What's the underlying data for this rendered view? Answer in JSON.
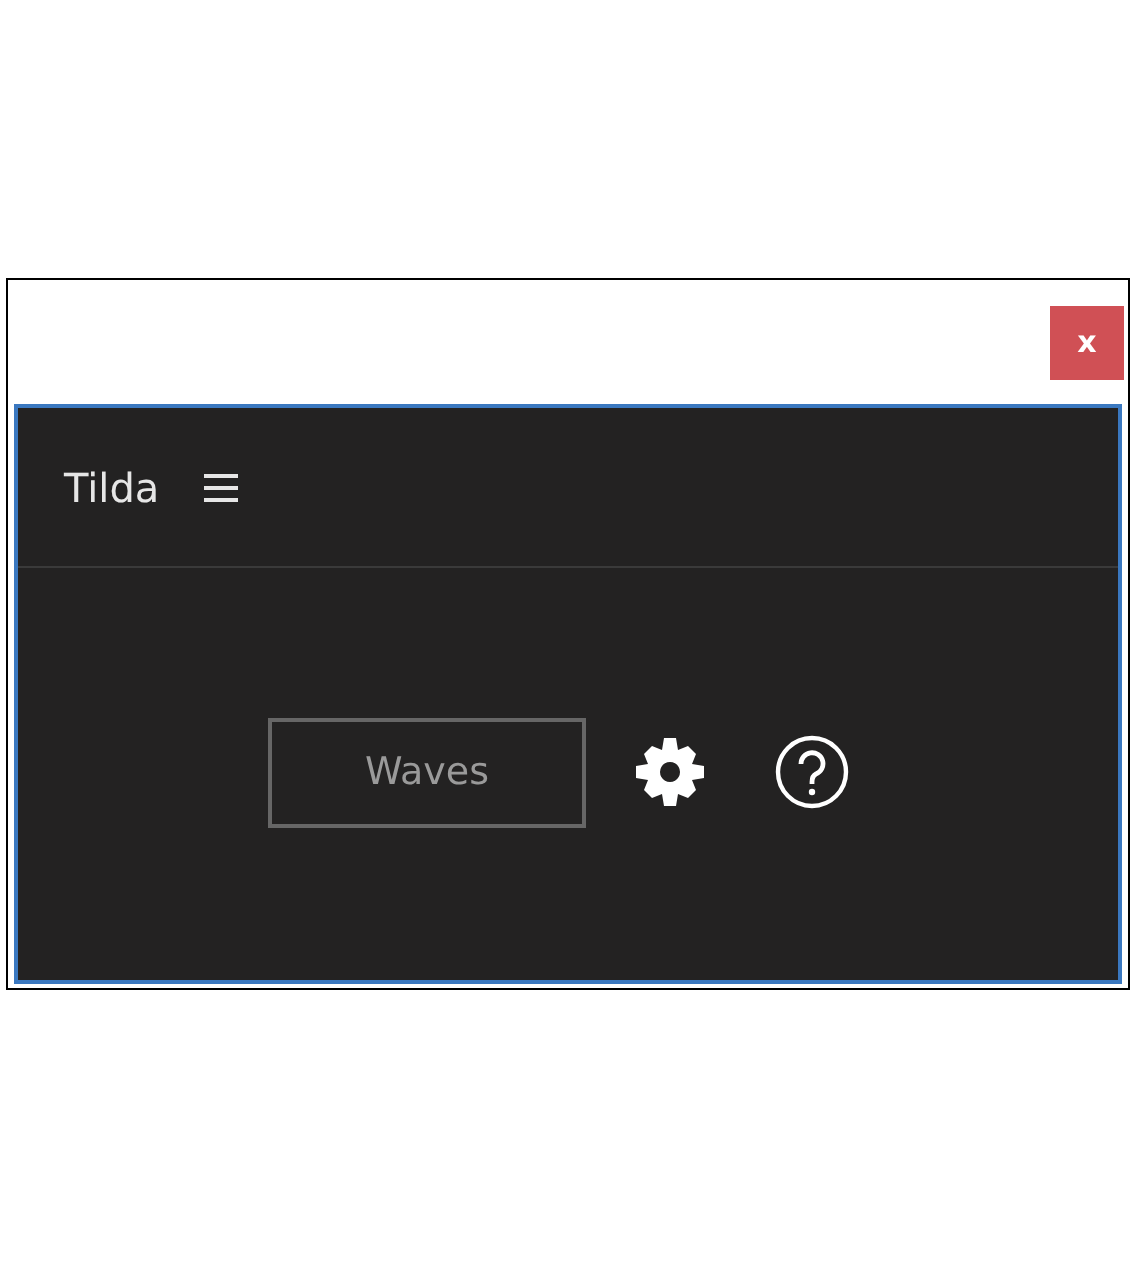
{
  "window": {
    "close": "x"
  },
  "panel": {
    "title": "Tilda",
    "button": "Waves"
  }
}
